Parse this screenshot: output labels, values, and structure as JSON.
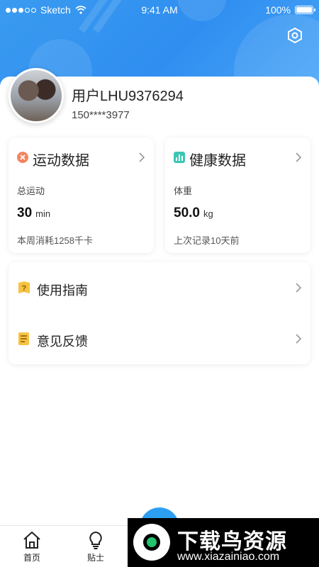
{
  "status_bar": {
    "carrier": "Sketch",
    "time": "9:41 AM",
    "battery": "100%"
  },
  "header": {
    "settings_icon": "hexagon-settings-icon"
  },
  "profile": {
    "username": "用户LHU9376294",
    "phone": "150****3977"
  },
  "sport_card": {
    "title": "运动数据",
    "label": "总运动",
    "value": "30",
    "unit": "min",
    "note": "本周消耗1258千卡",
    "icon_color": "#f4845f"
  },
  "health_card": {
    "title": "健康数据",
    "label": "体重",
    "value": "50.0",
    "unit": "kg",
    "note": "上次记录10天前",
    "icon_color": "#3cc6b4"
  },
  "menu": {
    "items": [
      {
        "label": "使用指南",
        "icon": "guide-icon"
      },
      {
        "label": "意见反馈",
        "icon": "feedback-icon"
      }
    ]
  },
  "tabbar": {
    "tabs": [
      {
        "label": "首页",
        "icon": "home-icon"
      },
      {
        "label": "贴士",
        "icon": "lightbulb-icon"
      }
    ]
  },
  "watermark": {
    "title": "下载鸟资源",
    "url": "www.xiazainiao.com"
  },
  "colors": {
    "header_blue": "#3a9bf0",
    "accent_blue": "#2d9ff2"
  }
}
